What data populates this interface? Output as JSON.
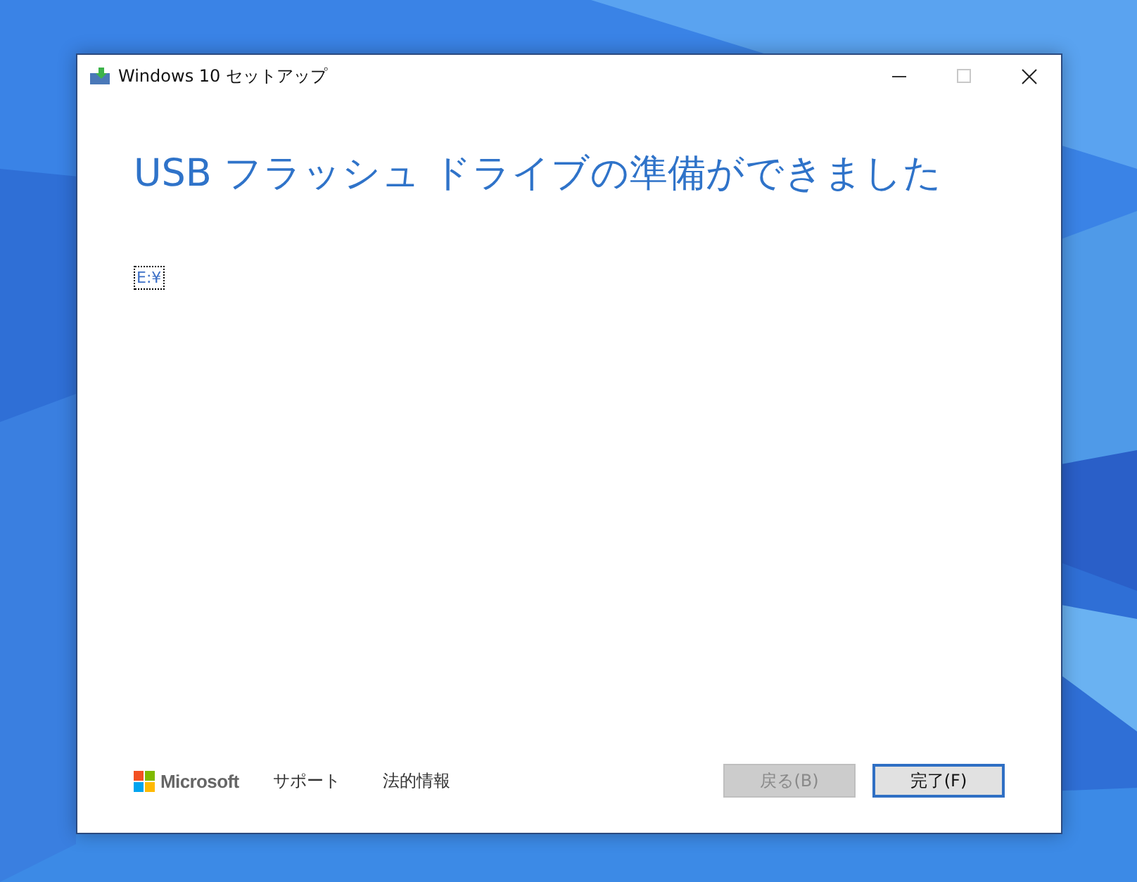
{
  "window": {
    "title": "Windows 10 セットアップ",
    "maximize_disabled": true
  },
  "heading": "USB フラッシュ ドライブの準備ができました",
  "drives": [
    {
      "label": "E:¥",
      "focused": true
    }
  ],
  "footer": {
    "brand": "Microsoft",
    "links": [
      "サポート",
      "法的情報"
    ],
    "buttons": [
      {
        "label": "戻る(B)",
        "disabled": true,
        "default": false
      },
      {
        "label": "完了(F)",
        "disabled": false,
        "default": true
      }
    ]
  }
}
